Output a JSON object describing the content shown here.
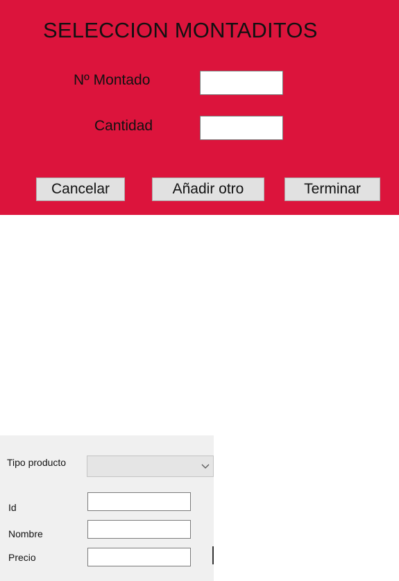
{
  "seleccion_dialog": {
    "title": "SELECCION MONTADITOS",
    "montado_label": "Nº Montado",
    "montado_value": "",
    "cantidad_label": "Cantidad",
    "cantidad_value": "",
    "buttons": {
      "cancel": "Cancelar",
      "add_another": "Añadir otro",
      "finish": "Terminar"
    },
    "background_color": "#dc143c"
  },
  "product_form": {
    "tipo_producto_label": "Tipo producto",
    "tipo_producto_selected": "",
    "id_label": "Id",
    "id_value": "",
    "nombre_label": "Nombre",
    "nombre_value": "",
    "precio_label": "Precio",
    "precio_value": "",
    "combo_icon": "chevron-down-icon"
  }
}
